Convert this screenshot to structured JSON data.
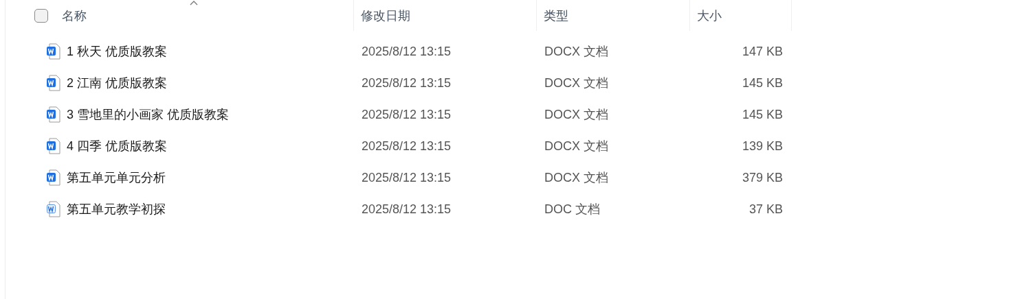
{
  "header": {
    "select_all": {
      "checked": false
    },
    "columns": [
      {
        "label": "名称",
        "sorted": true
      },
      {
        "label": "修改日期",
        "sorted": false
      },
      {
        "label": "类型",
        "sorted": false
      },
      {
        "label": "大小",
        "sorted": false
      }
    ]
  },
  "files": [
    {
      "name": "1 秋天 优质版教案",
      "kind": "docx",
      "modified": "2025/8/12 13:15",
      "type": "DOCX 文档",
      "size": "147 KB"
    },
    {
      "name": "2 江南 优质版教案",
      "kind": "docx",
      "modified": "2025/8/12 13:15",
      "type": "DOCX 文档",
      "size": "145 KB"
    },
    {
      "name": "3 雪地里的小画家 优质版教案",
      "kind": "docx",
      "modified": "2025/8/12 13:15",
      "type": "DOCX 文档",
      "size": "145 KB"
    },
    {
      "name": "4 四季 优质版教案",
      "kind": "docx",
      "modified": "2025/8/12 13:15",
      "type": "DOCX 文档",
      "size": "139 KB"
    },
    {
      "name": "第五单元单元分析",
      "kind": "docx",
      "modified": "2025/8/12 13:15",
      "type": "DOCX 文档",
      "size": "379 KB"
    },
    {
      "name": "第五单元教学初探",
      "kind": "doc",
      "modified": "2025/8/12 13:15",
      "type": "DOC 文档",
      "size": "37 KB"
    }
  ]
}
